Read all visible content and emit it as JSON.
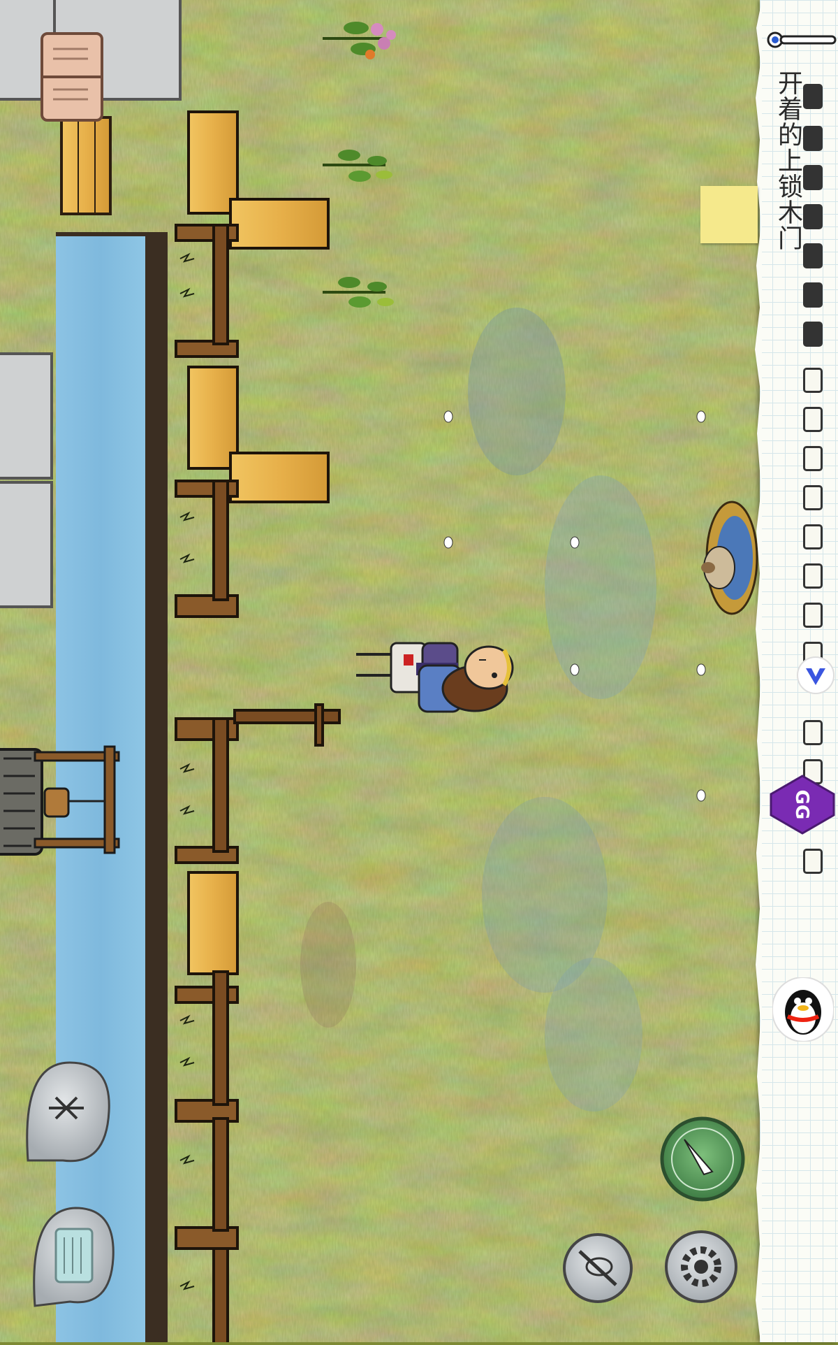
{
  "status": {
    "object_label": "开着的上锁木门"
  },
  "hud": {
    "thermometer": "thermometer-icon",
    "note": "sticky-note",
    "inventory_slots_filled": 8,
    "inventory_slots_total": 20,
    "vpn_icon": "v-shield-icon",
    "gg_icon": "gg-overlay-icon",
    "qq_icon": "qq-penguin-icon",
    "buttons": {
      "book": "recipe-book-icon",
      "emote": "emote-bubble-icon",
      "keyboard": "keyboard-bubble-icon",
      "sound": "sound-toggle-icon",
      "settings": "gear-icon",
      "compass": "compass-icon"
    }
  },
  "colors": {
    "grass": "#7e8a35",
    "water": "#86bde0",
    "stone": "#cfd1d2",
    "wood": "#e8b64c",
    "paper": "#fbfcf6",
    "gg_purple": "#7a2bb3"
  }
}
